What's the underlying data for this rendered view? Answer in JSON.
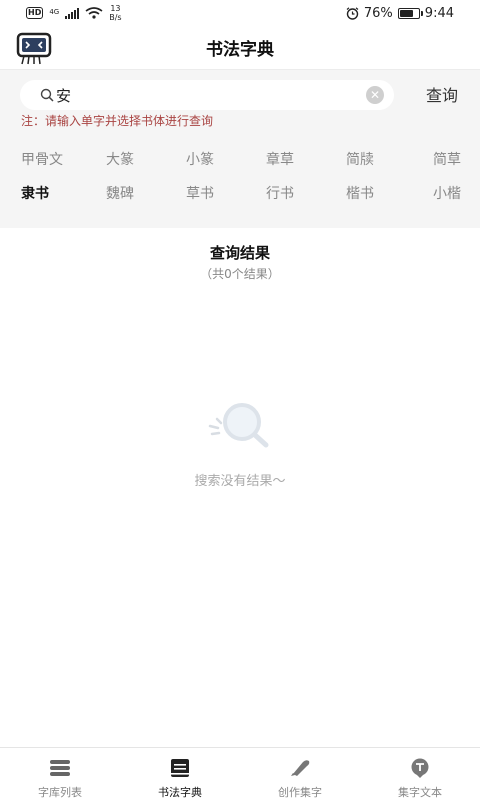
{
  "status_bar": {
    "hd": "HD",
    "network": "4G",
    "speed_value": "13",
    "speed_unit": "B/s",
    "battery": "76%",
    "battery_level": 0.76,
    "time": "9:44"
  },
  "header": {
    "title": "书法字典"
  },
  "search": {
    "value": "安",
    "query_label": "查询",
    "note": "注：请输入单字并选择书体进行查询"
  },
  "styles": {
    "row1": [
      "甲骨文",
      "大篆",
      "小篆",
      "章草",
      "简牍",
      "简草"
    ],
    "row2": [
      "隶书",
      "魏碑",
      "草书",
      "行书",
      "楷书",
      "小楷"
    ],
    "selected": "隶书"
  },
  "results": {
    "title": "查询结果",
    "count": "（共0个结果）",
    "empty": "搜索没有结果～"
  },
  "bottom_nav": {
    "items": [
      {
        "label": "字库列表",
        "icon": "layers-icon"
      },
      {
        "label": "书法字典",
        "icon": "book-icon"
      },
      {
        "label": "创作集字",
        "icon": "brush-icon"
      },
      {
        "label": "集字文本",
        "icon": "text-bubble-icon"
      }
    ],
    "active": "书法字典"
  },
  "colors": {
    "note": "#a94442",
    "panel": "#f5f5f5",
    "active": "#111111",
    "inactive": "#888888"
  }
}
